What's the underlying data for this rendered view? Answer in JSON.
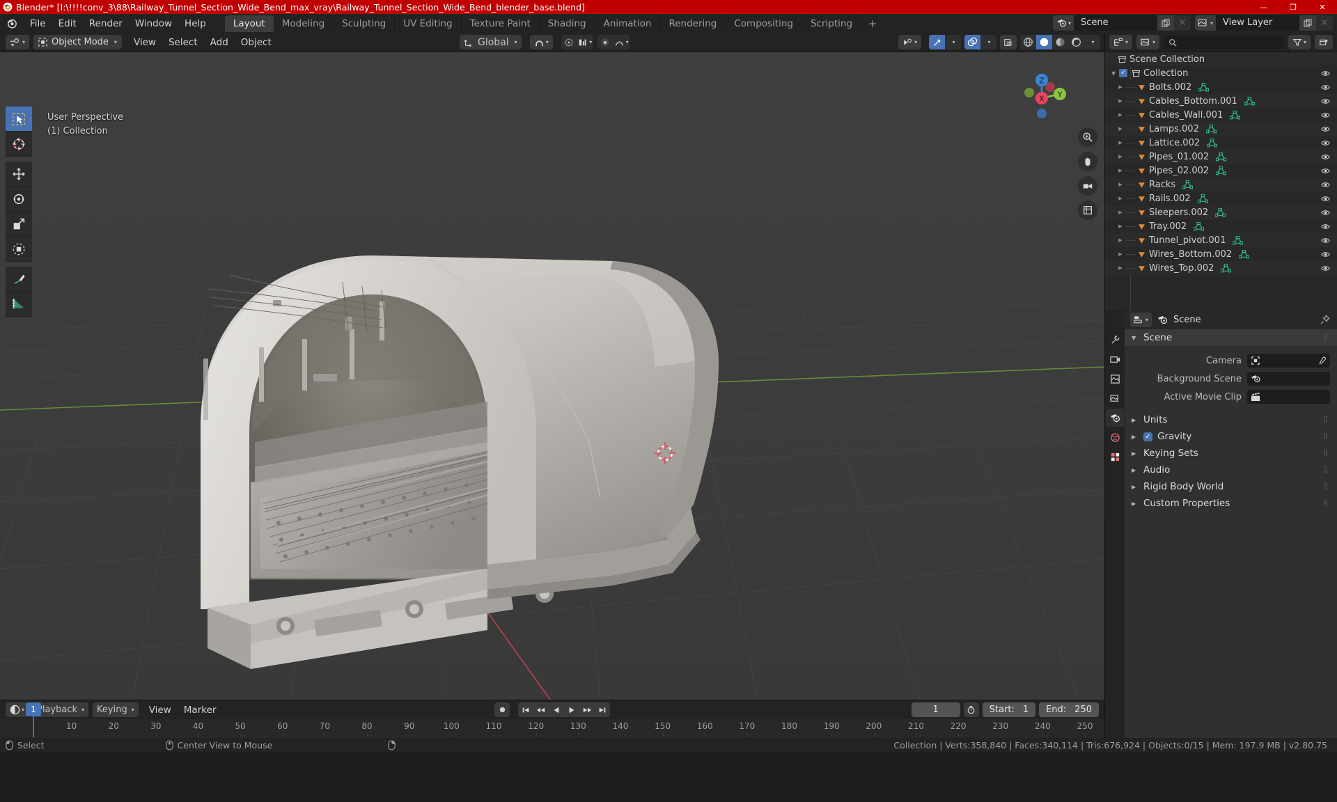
{
  "window": {
    "title": "Blender* [I:\\!!!!conv_3\\88\\Railway_Tunnel_Section_Wide_Bend_max_vray\\Railway_Tunnel_Section_Wide_Bend_blender_base.blend]",
    "minimize": "—",
    "maximize": "❐",
    "close": "✕",
    "app_icon": "blender-logo-icon"
  },
  "menus": [
    {
      "label": "File"
    },
    {
      "label": "Edit"
    },
    {
      "label": "Render"
    },
    {
      "label": "Window"
    },
    {
      "label": "Help"
    }
  ],
  "workspaces": {
    "tabs": [
      {
        "label": "Layout",
        "active": true
      },
      {
        "label": "Modeling",
        "active": false
      },
      {
        "label": "Sculpting",
        "active": false
      },
      {
        "label": "UV Editing",
        "active": false
      },
      {
        "label": "Texture Paint",
        "active": false
      },
      {
        "label": "Shading",
        "active": false
      },
      {
        "label": "Animation",
        "active": false
      },
      {
        "label": "Rendering",
        "active": false
      },
      {
        "label": "Compositing",
        "active": false
      },
      {
        "label": "Scripting",
        "active": false
      }
    ],
    "add_tab": "+"
  },
  "topbar_right": {
    "scene_name": "Scene",
    "view_layer_name": "View Layer"
  },
  "viewport_header": {
    "mode": "Object Mode",
    "menus": [
      {
        "label": "View"
      },
      {
        "label": "Select"
      },
      {
        "label": "Add"
      },
      {
        "label": "Object"
      }
    ],
    "transform_orientation": "Global"
  },
  "viewport": {
    "perspective": "User Perspective",
    "collection_line": "(1) Collection",
    "gizmo_axes": {
      "x": "X",
      "y": "Y",
      "z": "Z"
    },
    "tools": [
      {
        "name": "tweak-select-box",
        "active": true
      },
      {
        "name": "cursor",
        "active": false
      },
      {
        "name": "move",
        "active": false
      },
      {
        "name": "rotate",
        "active": false
      },
      {
        "name": "scale",
        "active": false
      },
      {
        "name": "transform",
        "active": false
      },
      {
        "name": "annotate",
        "active": false
      },
      {
        "name": "measure",
        "active": false
      }
    ]
  },
  "outliner": {
    "search_placeholder": "",
    "root": "Scene Collection",
    "collection": "Collection",
    "items": [
      {
        "label": "Bolts.002"
      },
      {
        "label": "Cables_Bottom.001"
      },
      {
        "label": "Cables_Wall.001"
      },
      {
        "label": "Lamps.002"
      },
      {
        "label": "Lattice.002"
      },
      {
        "label": "Pipes_01.002"
      },
      {
        "label": "Pipes_02.002"
      },
      {
        "label": "Racks"
      },
      {
        "label": "Rails.002"
      },
      {
        "label": "Sleepers.002"
      },
      {
        "label": "Tray.002"
      },
      {
        "label": "Tunnel_pivot.001"
      },
      {
        "label": "Wires_Bottom.002"
      },
      {
        "label": "Wires_Top.002"
      }
    ]
  },
  "properties": {
    "breadcrumb": "Scene",
    "panels": [
      {
        "label": "Scene",
        "open": true
      },
      {
        "label": "Units",
        "open": false
      },
      {
        "label": "Gravity",
        "open": false,
        "checked": true
      },
      {
        "label": "Keying Sets",
        "open": false
      },
      {
        "label": "Audio",
        "open": false
      },
      {
        "label": "Rigid Body World",
        "open": false
      },
      {
        "label": "Custom Properties",
        "open": false
      }
    ],
    "scene_fields": [
      {
        "label": "Camera",
        "value": "",
        "icon": "camera-icon"
      },
      {
        "label": "Background Scene",
        "value": "",
        "icon": "scene-icon"
      },
      {
        "label": "Active Movie Clip",
        "value": "",
        "icon": "clip-icon"
      }
    ]
  },
  "timeline": {
    "editor_menus": [
      {
        "label": "Playback",
        "dropdown": true
      },
      {
        "label": "Keying",
        "dropdown": true
      },
      {
        "label": "View",
        "dropdown": false
      },
      {
        "label": "Marker",
        "dropdown": false
      }
    ],
    "current_frame": "1",
    "start_label": "Start:",
    "start_value": "1",
    "end_label": "End:",
    "end_value": "250",
    "ticks": [
      "1",
      "10",
      "20",
      "30",
      "40",
      "50",
      "60",
      "70",
      "80",
      "90",
      "100",
      "110",
      "120",
      "130",
      "140",
      "150",
      "160",
      "170",
      "180",
      "190",
      "200",
      "210",
      "220",
      "230",
      "240",
      "250"
    ],
    "range": [
      1,
      250
    ]
  },
  "statusbar": {
    "left": [
      {
        "icon": "mouse-left-icon",
        "label": "Select"
      },
      {
        "icon": "mouse-middle-icon",
        "label": "Center View to Mouse"
      },
      {
        "icon": "mouse-right-icon",
        "label": ""
      }
    ],
    "stats": "Collection | Verts:358,840 | Faces:340,114 | Tris:676,924 | Objects:0/15 | Mem: 197.9 MB | v2.80.75"
  },
  "colors": {
    "title_bar": "#c00000",
    "accent": "#4772b3",
    "object_orange": "#e08a3c",
    "mesh_green": "#2ecc9a",
    "viewport_bg": "#3c3c3c",
    "axis_x": "#e8465e",
    "axis_y": "#8bc441",
    "axis_z": "#3a86d6"
  }
}
